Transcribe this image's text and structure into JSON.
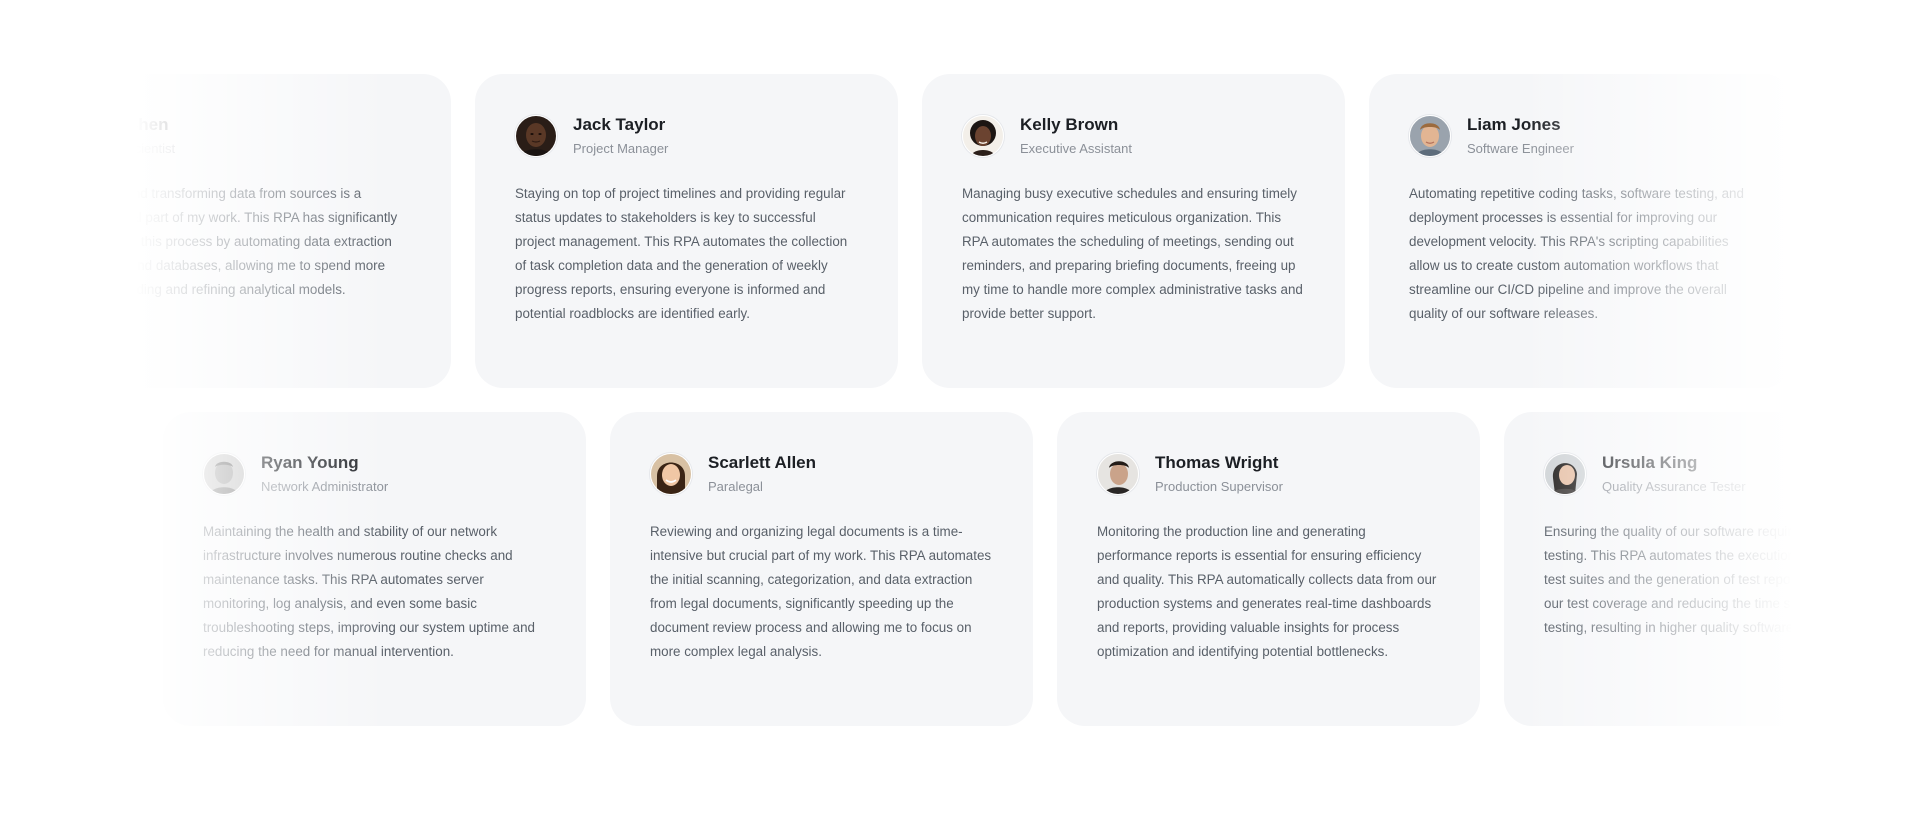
{
  "rows": [
    {
      "cards": [
        {
          "name": "Chen",
          "role": "Scientist",
          "quote": "cleaning, and transforming data from sources is a fundamental part of my work. This RPA has significantly streamlined this process by automating data extraction from APIs and databases, allowing me to spend more time on building and refining analytical models.",
          "avatar": "person-avatar"
        },
        {
          "name": "Jack Taylor",
          "role": "Project Manager",
          "quote": "Staying on top of project timelines and providing regular status updates to stakeholders is key to successful project management. This RPA automates the collection of task completion data and the generation of weekly progress reports, ensuring everyone is informed and potential roadblocks are identified early.",
          "avatar": "person-avatar"
        },
        {
          "name": "Kelly Brown",
          "role": "Executive Assistant",
          "quote": "Managing busy executive schedules and ensuring timely communication requires meticulous organization. This RPA automates the scheduling of meetings, sending out reminders, and preparing briefing documents, freeing up my time to handle more complex administrative tasks and provide better support.",
          "avatar": "person-avatar"
        },
        {
          "name": "Liam Jones",
          "role": "Software Engineer",
          "quote": "Automating repetitive coding tasks, software testing, and deployment processes is essential for improving our development velocity. This RPA's scripting capabilities allow us to create custom automation workflows that streamline our CI/CD pipeline and improve the overall quality of our software releases.",
          "avatar": "person-avatar"
        }
      ]
    },
    {
      "cards": [
        {
          "name": "Ryan Young",
          "role": "Network Administrator",
          "quote": "Maintaining the health and stability of our network infrastructure involves numerous routine checks and maintenance tasks. This RPA automates server monitoring, log analysis, and even some basic troubleshooting steps, improving our system uptime and reducing the need for manual intervention.",
          "avatar": "person-avatar"
        },
        {
          "name": "Scarlett Allen",
          "role": "Paralegal",
          "quote": "Reviewing and organizing legal documents is a time-intensive but crucial part of my work. This RPA automates the initial scanning, categorization, and data extraction from legal documents, significantly speeding up the document review process and allowing me to focus on more complex legal analysis.",
          "avatar": "person-avatar"
        },
        {
          "name": "Thomas Wright",
          "role": "Production Supervisor",
          "quote": "Monitoring the production line and generating performance reports is essential for ensuring efficiency and quality. This RPA automatically collects data from our production systems and generates real-time dashboards and reports, providing valuable insights for process optimization and identifying potential bottlenecks.",
          "avatar": "person-avatar"
        },
        {
          "name": "Ursula King",
          "role": "Quality Assurance Tester",
          "quote": "Ensuring the quality of our software requires thorough testing. This RPA automates the execution of regression test suites and the generation of test reports, increasing our test coverage and reducing the time spent on manual testing, resulting in higher quality software.",
          "avatar": "person-avatar"
        }
      ]
    }
  ],
  "colors": {
    "card_bg": "#f5f6f8",
    "name": "#1c1f24",
    "role": "#8b9098",
    "quote": "#596069",
    "page_bg": "#ffffff"
  }
}
